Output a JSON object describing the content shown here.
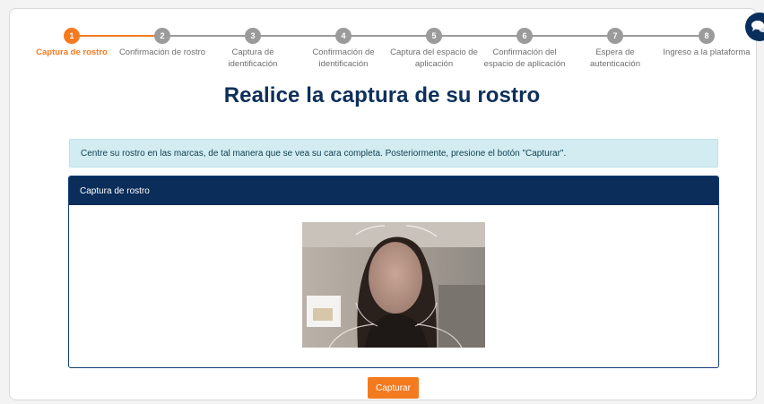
{
  "stepper": {
    "steps": [
      {
        "number": "1",
        "label": "Captura de rostro"
      },
      {
        "number": "2",
        "label": "Confirmación de rostro"
      },
      {
        "number": "3",
        "label": "Captura de\nidentificación"
      },
      {
        "number": "4",
        "label": "Confirmación de\nidentificación"
      },
      {
        "number": "5",
        "label": "Captura del espacio de\naplicación"
      },
      {
        "number": "6",
        "label": "Confirmación del\nespacio de aplicación"
      },
      {
        "number": "7",
        "label": "Espera de\nautenticación"
      },
      {
        "number": "8",
        "label": "Ingreso a la plataforma"
      }
    ],
    "active_step": 1
  },
  "chat_icon": "chat-bubbles-icon",
  "page_title": "Realice la captura de su rostro",
  "instructions": "Centre su rostro en las marcas, de tal manera que se vea su cara completa. Posteriormente, presione el botón \"Capturar\".",
  "panel": {
    "header": "Captura de rostro"
  },
  "capture_button": "Capturar",
  "colors": {
    "accent": "#f47a20",
    "navy": "#0a2d59",
    "info_bg": "#d2ecf2",
    "inactive": "#9b9b9b"
  }
}
